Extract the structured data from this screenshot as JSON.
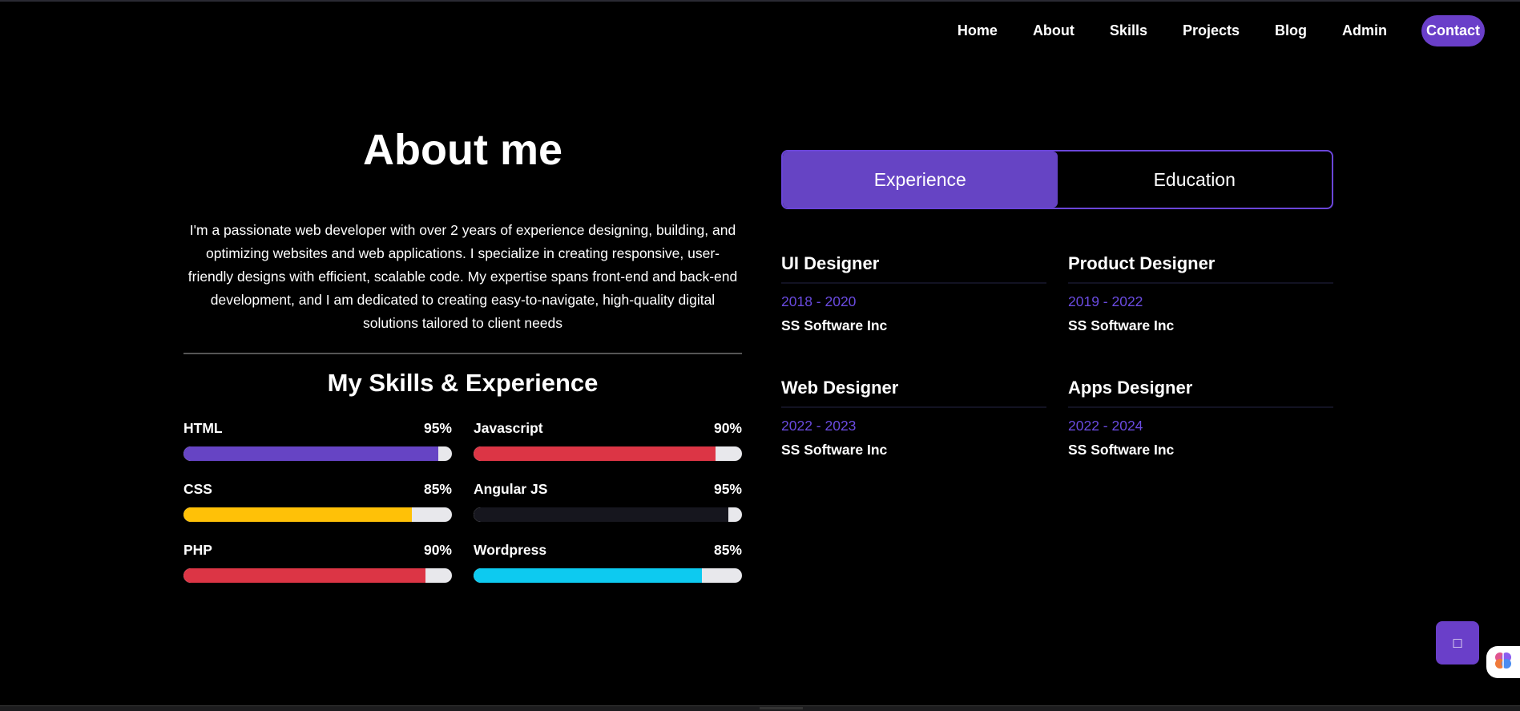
{
  "nav": {
    "items": [
      "Home",
      "About",
      "Skills",
      "Projects",
      "Blog",
      "Admin"
    ],
    "contact": "Contact"
  },
  "about": {
    "title": "About me",
    "text": "I'm a passionate web developer with over 2 years of experience designing, building, and optimizing websites and web applications. I specialize in creating responsive, user-friendly designs with efficient, scalable code. My expertise spans front-end and back-end development, and I am dedicated to creating easy-to-navigate, high-quality digital solutions tailored to client needs"
  },
  "skills": {
    "title": "My Skills & Experience",
    "items": [
      {
        "name": "HTML",
        "percent": "95%",
        "value": 95,
        "color": "#6644c4"
      },
      {
        "name": "Javascript",
        "percent": "90%",
        "value": 90,
        "color": "#dc3545"
      },
      {
        "name": "CSS",
        "percent": "85%",
        "value": 85,
        "color": "#ffc107"
      },
      {
        "name": "Angular JS",
        "percent": "95%",
        "value": 95,
        "color": "#16161e"
      },
      {
        "name": "PHP",
        "percent": "90%",
        "value": 90,
        "color": "#dc3545"
      },
      {
        "name": "Wordpress",
        "percent": "85%",
        "value": 85,
        "color": "#0dcaf0"
      }
    ]
  },
  "tabs": {
    "experience": "Experience",
    "education": "Education"
  },
  "experience": [
    {
      "title": "UI Designer",
      "years": "2018 - 2020",
      "company": "SS Software Inc"
    },
    {
      "title": "Product Designer",
      "years": "2019 - 2022",
      "company": "SS Software Inc"
    },
    {
      "title": "Web Designer",
      "years": "2022 - 2023",
      "company": "SS Software Inc"
    },
    {
      "title": "Apps Designer",
      "years": "2022 - 2024",
      "company": "SS Software Inc"
    }
  ],
  "floating": {
    "button_glyph": "□",
    "badge_icon": "brain-icon"
  },
  "colors": {
    "accent": "#6644c4",
    "years": "#6a4be0"
  }
}
